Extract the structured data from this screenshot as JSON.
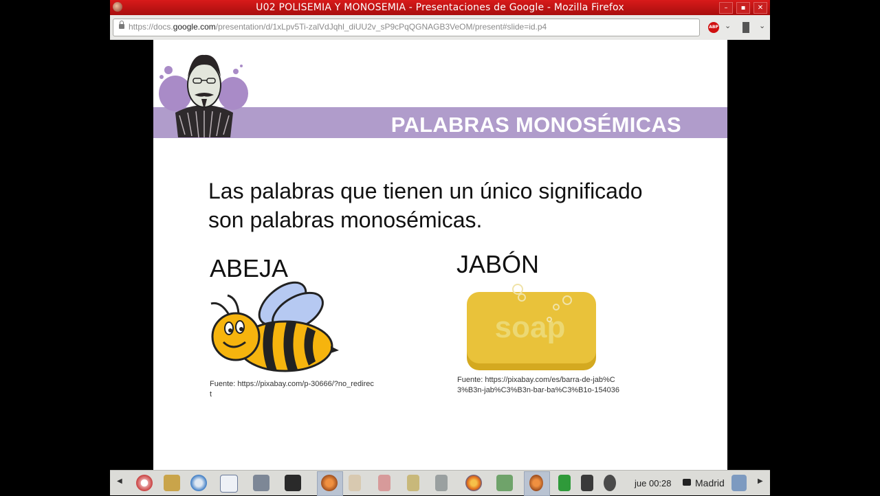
{
  "window": {
    "title": "U02 POLISEMIA Y MONOSEMIA - Presentaciones de Google - Mozilla Firefox",
    "controls": [
      "–",
      "▪",
      "✕"
    ]
  },
  "urlbar": {
    "prefix": "https://docs.",
    "domain": "google.com",
    "path": "/presentation/d/1xLpv5Ti-zalVdJqhl_diUU2v_sP9cPqQGNAGB3VeOM/present#slide=id.p4"
  },
  "toolbar": {
    "abp_label": "ABP"
  },
  "slide": {
    "heading": "PALABRAS MONOSÉMICAS",
    "body_line1": "Las palabras que tienen un único significado",
    "body_line2": "son palabras monosémicas.",
    "example1": {
      "word": "ABEJA",
      "source": "Fuente: https://pixabay.com/p-30666/?no_redirect"
    },
    "example2": {
      "word": "JABÓN",
      "soap_text": "soap",
      "source": "Fuente: https://pixabay.com/es/barra-de-jab%C3%B3n-jab%C3%B3n-bar-ba%C3%B1o-154036"
    }
  },
  "taskbar": {
    "clock": "jue 00:28",
    "location": "Madrid"
  },
  "colors": {
    "titlebar": "#c01414",
    "band": "#b09ccb",
    "bee_yellow": "#f6b40e",
    "bee_wing": "#b6c9f2",
    "soap": "#e9c23a"
  }
}
